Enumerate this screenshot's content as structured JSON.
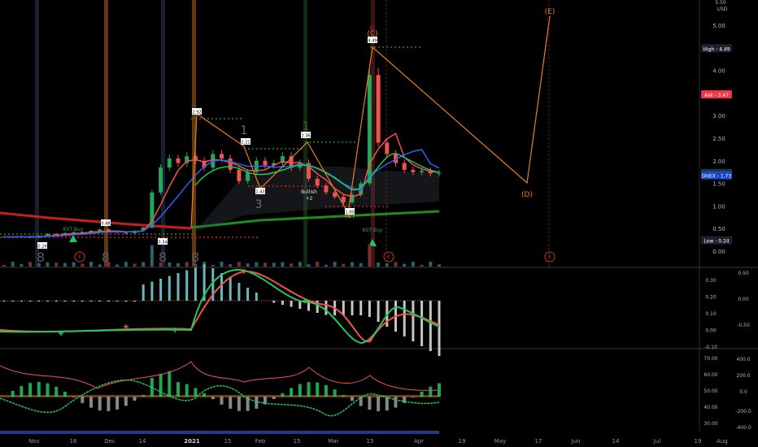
{
  "currency": "USD",
  "top_price_partial": "5.50",
  "chart_data": [
    {
      "type": "candlestick",
      "pane": "price",
      "x_ticks": [
        "Nov",
        "16",
        "Dec",
        "14",
        "2021",
        "15",
        "Feb",
        "15",
        "Mar",
        "15",
        "Apr",
        "19",
        "May",
        "17",
        "Jun",
        "14",
        "Jul",
        "19",
        "Aug"
      ],
      "y_ticks": [
        "5.00",
        "4.50",
        "4.00",
        "3.50",
        "3.00",
        "2.50",
        "2.00",
        "1.50",
        "1.00",
        "0.50",
        "0.00"
      ],
      "ylim": [
        -0.1,
        5.3
      ],
      "price_tags": [
        {
          "name": "High",
          "text": "High - 4.49",
          "value": 4.49,
          "color": "#ffffff",
          "bg": "#1e222d"
        },
        {
          "name": "Ask",
          "text": "Ask - 3.47",
          "value": 3.47,
          "color": "#ffffff",
          "bg": "#f23645"
        },
        {
          "name": "Bid",
          "text": "Bid - 1.73",
          "value": 1.73,
          "color": "#ffffff",
          "bg": "#1e3a2e"
        },
        {
          "name": "DHEX",
          "text": "DHEX - 1.73",
          "value": 1.68,
          "color": "#ffffff",
          "bg": "#1848cc"
        },
        {
          "name": "Low",
          "text": "Low - 0.24",
          "value": 0.24,
          "color": "#ffffff",
          "bg": "#1e222d"
        }
      ],
      "wave_labels": [
        "(C)",
        "(E)",
        "(D)",
        "(E)"
      ],
      "price_callouts": [
        "0.24",
        "0.48",
        "0.34",
        "2.92",
        "2.21",
        "1.43",
        "2.36",
        "1.00",
        "4.49"
      ],
      "annotations": [
        "KST Buy",
        "KST Buy",
        "Bullish",
        "+2",
        "1",
        "3",
        "1",
        "5",
        "E",
        "E",
        "E"
      ],
      "series": [
        {
          "name": "close",
          "values": [
            0.32,
            0.31,
            0.33,
            0.3,
            0.34,
            0.38,
            0.36,
            0.4,
            0.42,
            0.4,
            0.45,
            0.48,
            0.44,
            0.41,
            0.4,
            0.45,
            0.52,
            1.3,
            1.85,
            2.05,
            1.95,
            2.1,
            2.0,
            1.85,
            2.15,
            2.05,
            1.8,
            1.55,
            1.75,
            2.0,
            1.9,
            1.95,
            2.1,
            1.85,
            1.95,
            1.6,
            1.45,
            1.3,
            1.2,
            1.08,
            1.25,
            1.5,
            3.9,
            2.4,
            2.15,
            1.95,
            1.8,
            1.75,
            1.78,
            1.72,
            1.73
          ]
        }
      ]
    },
    {
      "type": "line",
      "pane": "macd",
      "y_ticks_left": [
        "0.30",
        "0.20",
        "0.10",
        "0.00",
        "-0.10"
      ],
      "y_ticks_right": [
        "0.50",
        "0.00",
        "-0.50"
      ]
    },
    {
      "type": "line",
      "pane": "rsi",
      "y_ticks_left": [
        "70.00",
        "60.00",
        "50.00",
        "40.00",
        "30.00"
      ],
      "y_ticks_right": [
        "400.0",
        "200.0",
        "0.0",
        "-200.0",
        "-400.0"
      ]
    }
  ]
}
